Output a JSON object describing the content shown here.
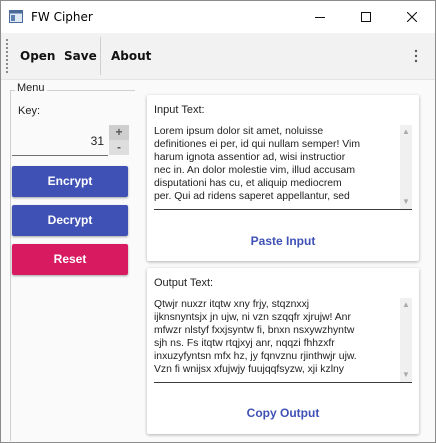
{
  "window": {
    "title": "FW Cipher"
  },
  "toolbar": {
    "items": [
      {
        "label": "Open"
      },
      {
        "label": "Save"
      },
      {
        "label": "About"
      }
    ]
  },
  "menu": {
    "title": "Menu",
    "key_label": "Key:",
    "key_value": "31",
    "stepper_up": "+",
    "stepper_down": "-",
    "encrypt_label": "Encrypt",
    "decrypt_label": "Decrypt",
    "reset_label": "Reset"
  },
  "input": {
    "label": "Input Text:",
    "text_lines": [
      "Lorem ipsum dolor sit amet, noluisse",
      "definitiones ei per, id qui nullam semper! Vim",
      "harum ignota assentior ad, wisi instructior",
      "nec in. An dolor molestie vim, illud accusam",
      "disputationi has cu, et aliquip mediocrem",
      "per. Qui ad ridens saperet appellantur, sed"
    ],
    "action_label": "Paste Input"
  },
  "output": {
    "label": "Output Text:",
    "text_lines": [
      "Qtwjr nuxzr itqtw xny frjy, stqznxxj",
      "ijknsnyntsjx jn ujw, ni vzn szqqfr xjrujw! Anr",
      "mfwzr nlstyf fxxjsyntw fi, bnxn nsxywzhyntw",
      "sjh ns. Fs itqtw rtqjxyj anr, nqqzi fhhzxfr",
      "inxuzyfyntsn mfx hz, jy fqnvznu rjinthwjr ujw.",
      "Vzn fi wnijsx xfujwjy fuujqqfsyzw, xji kzlny"
    ],
    "action_label": "Copy Output"
  },
  "colors": {
    "primary": "#3f51b5",
    "reset": "#d81b60",
    "action_text": "#3f51b5"
  }
}
